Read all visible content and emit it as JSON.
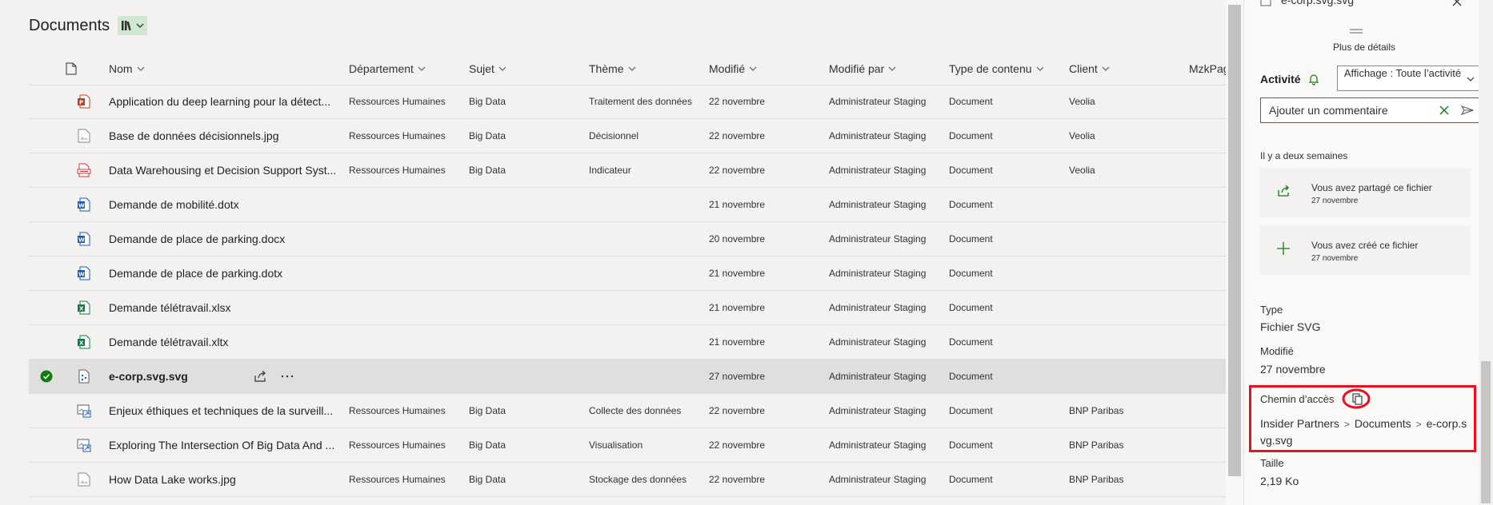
{
  "library": {
    "title": "Documents"
  },
  "columns": {
    "nom": "Nom",
    "departement": "Département",
    "sujet": "Sujet",
    "theme": "Thème",
    "modifie": "Modifié",
    "modifie_par": "Modifié par",
    "type_contenu": "Type de contenu",
    "client": "Client",
    "mzk": "MzkPag"
  },
  "rows": [
    {
      "icon": "powerpoint",
      "nom": "Application du deep learning pour la détect...",
      "departement": "Ressources Humaines",
      "sujet": "Big Data",
      "theme": "Traitement des données",
      "modifie": "22 novembre",
      "modifie_par": "Administrateur Staging",
      "type": "Document",
      "client": "Veolia"
    },
    {
      "icon": "image",
      "nom": "Base de données décisionnels.jpg",
      "departement": "Ressources Humaines",
      "sujet": "Big Data",
      "theme": "Décisionnel",
      "modifie": "22 novembre",
      "modifie_par": "Administrateur Staging",
      "type": "Document",
      "client": "Veolia"
    },
    {
      "icon": "pdf",
      "nom": "Data Warehousing et Decision Support Syst...",
      "departement": "Ressources Humaines",
      "sujet": "Big Data",
      "theme": "Indicateur",
      "modifie": "22 novembre",
      "modifie_par": "Administrateur Staging",
      "type": "Document",
      "client": "Veolia"
    },
    {
      "icon": "word",
      "nom": "Demande de mobilité.dotx",
      "departement": "",
      "sujet": "",
      "theme": "",
      "modifie": "21 novembre",
      "modifie_par": "Administrateur Staging",
      "type": "Document",
      "client": ""
    },
    {
      "icon": "word",
      "nom": "Demande de place de parking.docx",
      "departement": "",
      "sujet": "",
      "theme": "",
      "modifie": "20 novembre",
      "modifie_par": "Administrateur Staging",
      "type": "Document",
      "client": ""
    },
    {
      "icon": "word",
      "nom": "Demande de place de parking.dotx",
      "departement": "",
      "sujet": "",
      "theme": "",
      "modifie": "21 novembre",
      "modifie_par": "Administrateur Staging",
      "type": "Document",
      "client": ""
    },
    {
      "icon": "excel",
      "nom": "Demande télétravail.xlsx",
      "departement": "",
      "sujet": "",
      "theme": "",
      "modifie": "21 novembre",
      "modifie_par": "Administrateur Staging",
      "type": "Document",
      "client": ""
    },
    {
      "icon": "excel",
      "nom": "Demande télétravail.xltx",
      "departement": "",
      "sujet": "",
      "theme": "",
      "modifie": "21 novembre",
      "modifie_par": "Administrateur Staging",
      "type": "Document",
      "client": ""
    },
    {
      "icon": "svgfile",
      "nom": "e-corp.svg.svg",
      "departement": "",
      "sujet": "",
      "theme": "",
      "modifie": "27 novembre",
      "modifie_par": "Administrateur Staging",
      "type": "Document",
      "client": "",
      "selected": true
    },
    {
      "icon": "link",
      "nom": "Enjeux éthiques et techniques de la surveill...",
      "departement": "Ressources Humaines",
      "sujet": "Big Data",
      "theme": "Collecte des données",
      "modifie": "22 novembre",
      "modifie_par": "Administrateur Staging",
      "type": "Document",
      "client": "BNP Paribas"
    },
    {
      "icon": "link",
      "nom": "Exploring The Intersection Of Big Data And ...",
      "departement": "Ressources Humaines",
      "sujet": "Big Data",
      "theme": "Visualisation",
      "modifie": "22 novembre",
      "modifie_par": "Administrateur Staging",
      "type": "Document",
      "client": "BNP Paribas"
    },
    {
      "icon": "image",
      "nom": "How Data Lake works.jpg",
      "departement": "Ressources Humaines",
      "sujet": "Big Data",
      "theme": "Stockage des données",
      "modifie": "22 novembre",
      "modifie_par": "Administrateur Staging",
      "type": "Document",
      "client": "BNP Paribas"
    }
  ],
  "panel": {
    "filename": "e-corp.svg.svg",
    "more_details": "Plus de détails",
    "activity_label": "Activité",
    "view_option": "Affichage : Toute l’activité",
    "comment_placeholder": "Ajouter un commentaire",
    "time_group": "Il y a deux semaines",
    "activities": [
      {
        "text": "Vous avez partagé ce fichier",
        "date": "27 novembre"
      },
      {
        "text": "Vous avez créé ce fichier",
        "date": "27 novembre"
      }
    ],
    "type_label": "Type",
    "type_value": "Fichier SVG",
    "modified_label": "Modifié",
    "modified_value": "27 novembre",
    "path_label": "Chemin d’accès",
    "path": [
      "Insider Partners",
      "Documents",
      "e-corp.svg.svg"
    ],
    "size_label": "Taille",
    "size_value": "2,19 Ko"
  },
  "colors": {
    "accent_green": "#107c10",
    "highlight_red": "#e81123",
    "selected_row": "#e1dfdd"
  }
}
